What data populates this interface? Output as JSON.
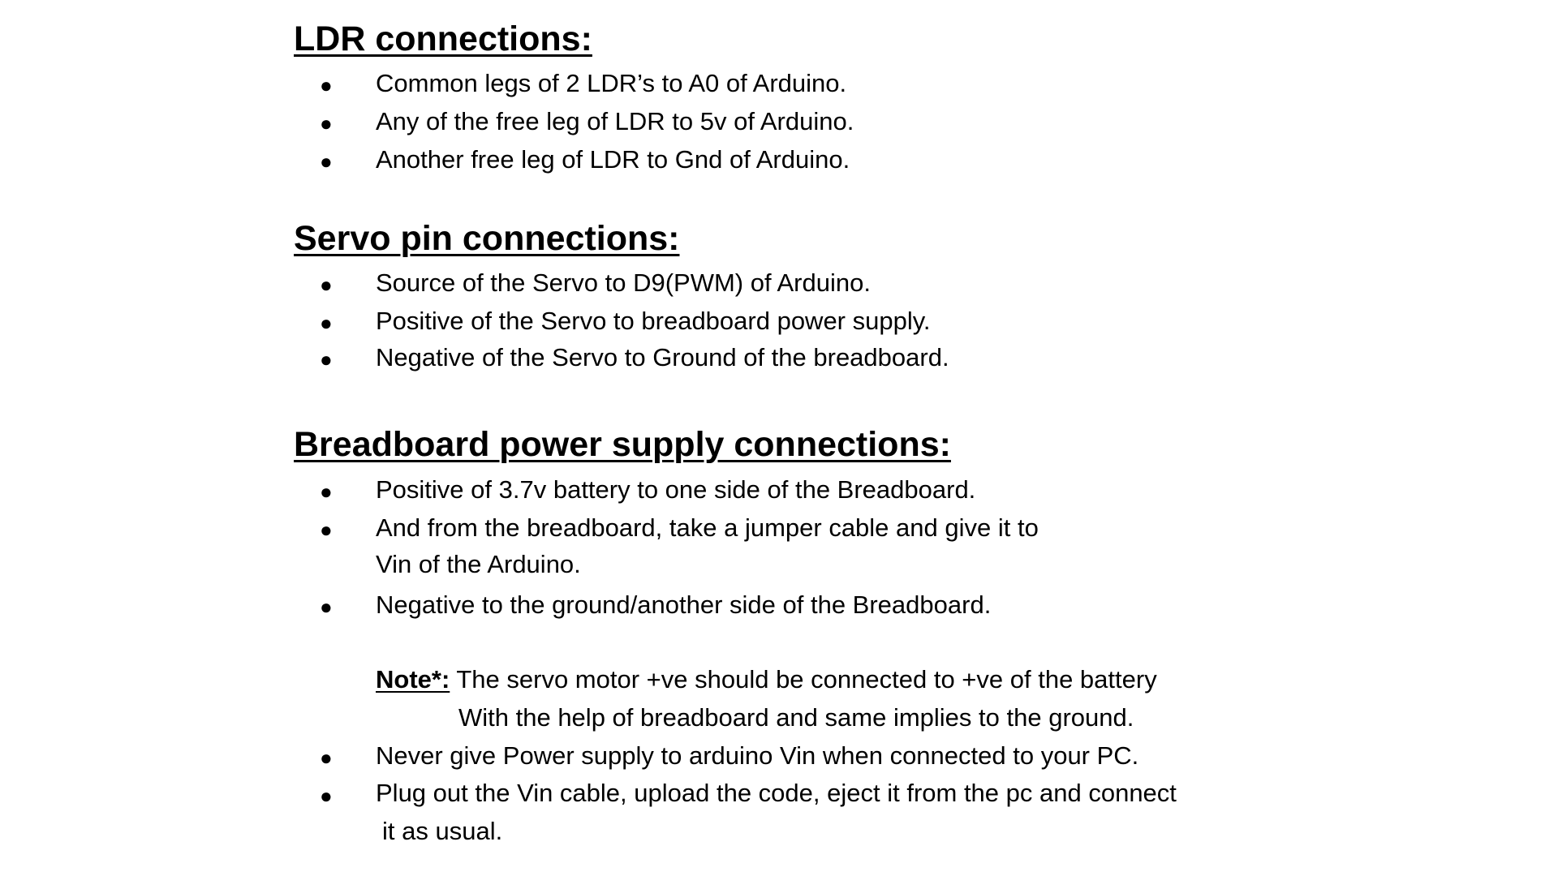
{
  "bullet_glyph": "●",
  "sections": [
    {
      "heading": "LDR connections:",
      "items": [
        "Common legs of 2 LDR’s to A0 of Arduino.",
        "Any of the free leg of LDR to 5v of Arduino.",
        "Another free leg of LDR to Gnd of Arduino."
      ]
    },
    {
      "heading": "Servo pin connections:",
      "items": [
        "Source of the Servo to D9(PWM) of Arduino.",
        "Positive of the Servo to breadboard power supply.",
        "Negative of the Servo to Ground of the breadboard."
      ]
    },
    {
      "heading": "Breadboard power supply connections:",
      "items": [
        "Positive of 3.7v battery to one side of the Breadboard.",
        "And from the breadboard, take a jumper cable and give it to",
        "Vin of the Arduino.",
        "Negative to the ground/another side of the Breadboard."
      ],
      "note": {
        "label": "Note*:",
        "line1": "The servo motor +ve should be connected to +ve of the battery",
        "line2": "With the help of breadboard and same implies to the ground."
      },
      "items_after_note": [
        "Never give Power supply to arduino Vin when connected to your PC.",
        "Plug out the Vin cable, upload the code, eject it from the pc and connect",
        "it as usual."
      ]
    }
  ]
}
